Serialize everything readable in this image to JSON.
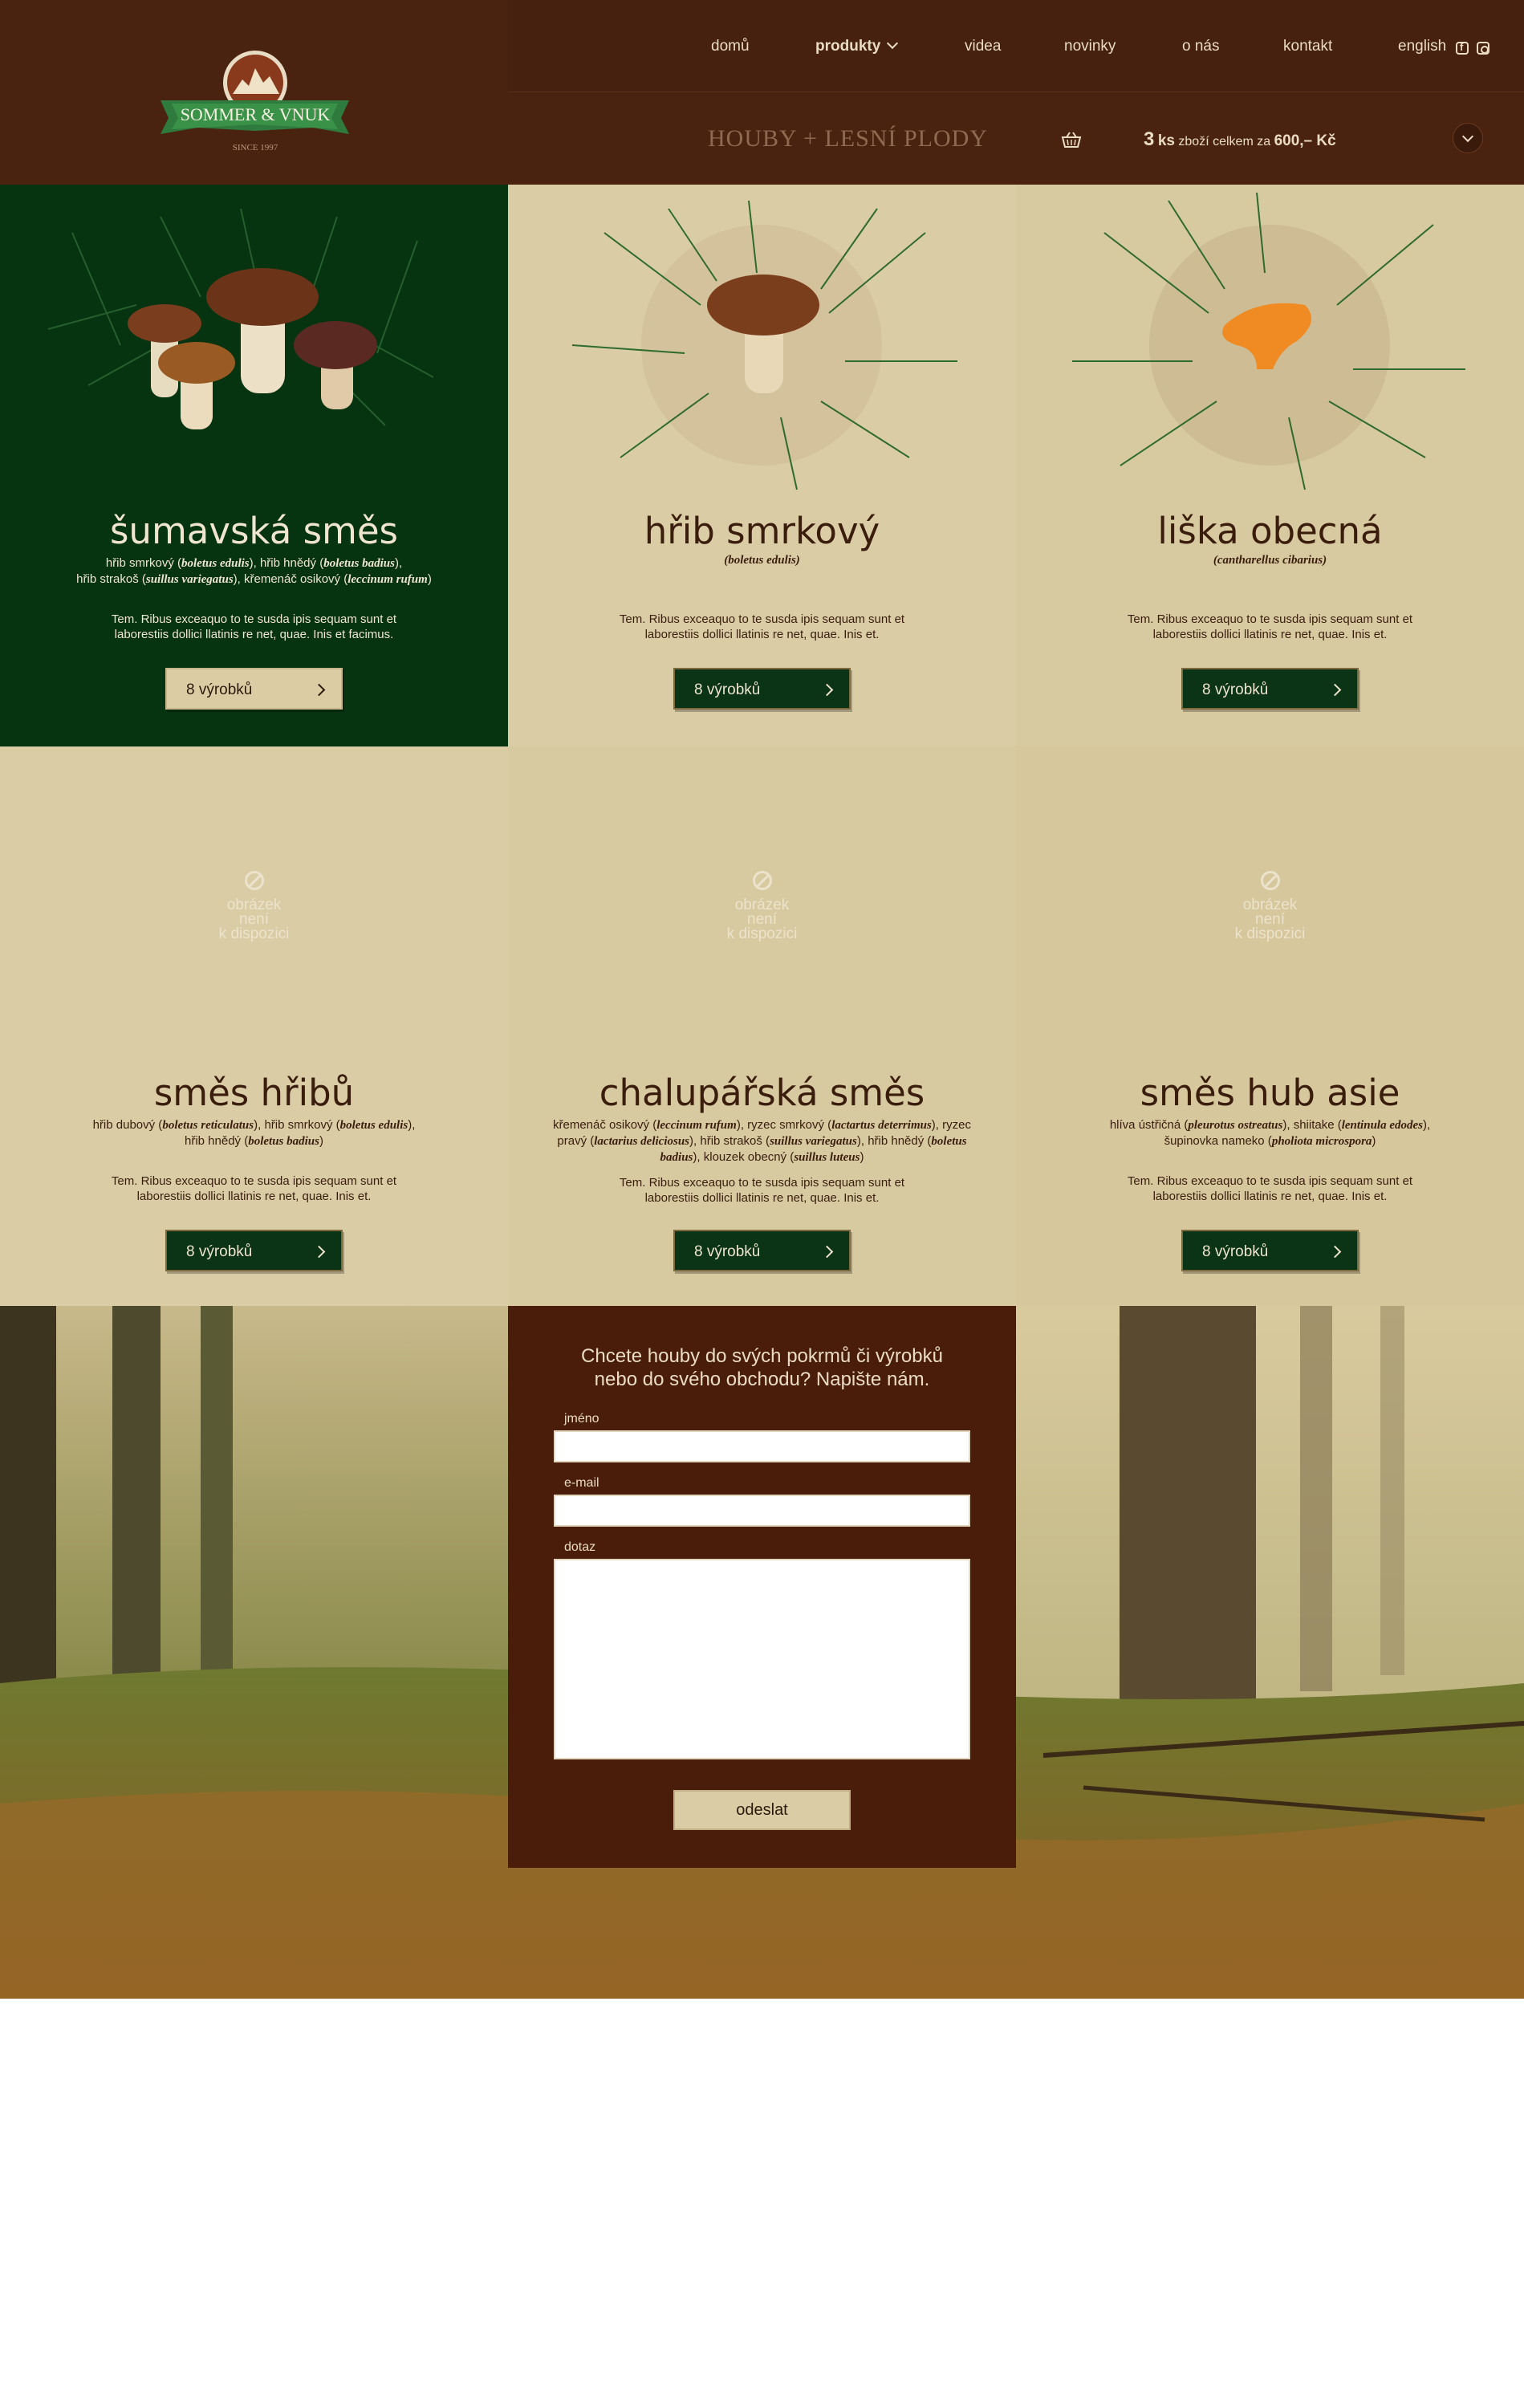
{
  "brand": {
    "name": "SOMMER & VNUK",
    "since": "SINCE 1997"
  },
  "nav": {
    "items": [
      "domů",
      "produkty",
      "videa",
      "novinky",
      "o nás",
      "kontakt",
      "english"
    ]
  },
  "subheader": {
    "title": "HOUBY + LESNÍ PLODY",
    "cart_count": "3",
    "cart_unit": "ks",
    "cart_label": "zboží celkem za",
    "cart_total": "600,– Kč"
  },
  "products": [
    {
      "title": "šumavská směs",
      "species": [
        [
          "hřib smrkový",
          "boletus edulis"
        ],
        [
          "hřib hnědý",
          "boletus badius"
        ],
        [
          "hřib strakoš",
          "suillus variegatus"
        ],
        [
          "křemenáč osikový",
          "leccinum rufum"
        ]
      ],
      "desc": "Tem. Ribus exceaquo to te susda ipis sequam sunt et laborestiis dollici llatinis re net, quae. Inis et facimus.",
      "button": "8 výrobků"
    },
    {
      "title": "hřib smrkový",
      "latin": "(boletus edulis)",
      "desc": "Tem. Ribus exceaquo to te susda ipis sequam sunt et laborestiis dollici llatinis re net, quae. Inis et.",
      "button": "8 výrobků"
    },
    {
      "title": "liška obecná",
      "latin": "(cantharellus cibarius)",
      "desc": "Tem. Ribus exceaquo to te susda ipis sequam sunt et laborestiis dollici llatinis re net, quae. Inis et.",
      "button": "8 výrobků"
    },
    {
      "title": "směs hřibů",
      "no_image": [
        "obrázek",
        "není",
        "k dispozici"
      ],
      "species": [
        [
          "hřib dubový",
          "boletus reticulatus"
        ],
        [
          "hřib smrkový",
          "boletus edulis"
        ],
        [
          "hřib hnědý",
          "boletus badius"
        ]
      ],
      "desc": "Tem. Ribus exceaquo to te susda ipis sequam sunt et laborestiis dollici llatinis re net, quae. Inis et.",
      "button": "8 výrobků"
    },
    {
      "title": "chalupářská směs",
      "no_image": [
        "obrázek",
        "není",
        "k dispozici"
      ],
      "species": [
        [
          "křemenáč osikový",
          "leccinum rufum"
        ],
        [
          "ryzec smrkový",
          "lactartus deterrimus"
        ],
        [
          "ryzec pravý",
          "lactarius deliciosus"
        ],
        [
          "hřib strakoš",
          "suillus variegatus"
        ],
        [
          "hřib hnědý",
          "boletus badius"
        ],
        [
          "klouzek obecný",
          "suillus luteus"
        ]
      ],
      "desc": "Tem. Ribus exceaquo to te susda ipis sequam sunt et laborestiis dollici llatinis re net, quae. Inis et.",
      "button": "8 výrobků"
    },
    {
      "title": "směs hub asie",
      "no_image": [
        "obrázek",
        "není",
        "k dispozici"
      ],
      "species": [
        [
          "hlíva ústřičná",
          "pleurotus ostreatus"
        ],
        [
          "shiitake",
          "lentinula edodes"
        ],
        [
          "šupinovka nameko",
          "pholiota microspora"
        ]
      ],
      "desc": "Tem. Ribus exceaquo to te susda ipis sequam sunt et laborestiis dollici llatinis re net, quae. Inis et.",
      "button": "8 výrobků"
    }
  ],
  "contact": {
    "heading_1": "Chcete houby do svých pokrmů či výrobků",
    "heading_2": "nebo do svého obchodu? Napište nám.",
    "name_label": "jméno",
    "email_label": "e-mail",
    "query_label": "dotaz",
    "submit": "odeslat"
  },
  "colors": {
    "header": "#4a2310",
    "green": "#063310",
    "beige": "#dacda6",
    "form": "#4a1d0a"
  }
}
